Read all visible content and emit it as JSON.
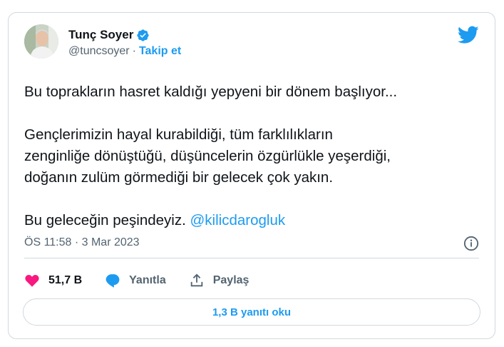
{
  "author": {
    "display_name": "Tunç Soyer",
    "handle": "@tuncsoyer",
    "separator": "·",
    "follow_label": "Takip et",
    "verified": true
  },
  "tweet": {
    "line1": "Bu toprakların hasret kaldığı yepyeni bir dönem başlıyor...",
    "line2": "Gençlerimizin hayal kurabildiği, tüm farklılıkların",
    "line3": "zenginliğe dönüştüğü, düşüncelerin özgürlükle yeşerdiği,",
    "line4": "doğanın zulüm görmediği bir gelecek çok yakın.",
    "line5": "Bu geleceğin peşindeyiz.",
    "mention": "@kilicdarogluk"
  },
  "meta": {
    "timestamp": "ÖS 11:58 · 3 Mar 2023"
  },
  "actions": {
    "like_count": "51,7 B",
    "reply_label": "Yanıtla",
    "share_label": "Paylaş"
  },
  "replies_button": {
    "label": "1,3 B yanıtı oku"
  },
  "colors": {
    "accent": "#1d9bf0",
    "like": "#f91880",
    "text": "#0f1419",
    "secondary": "#536471",
    "border": "#cfd9de"
  },
  "icons": [
    "verified-icon",
    "twitter-bird-icon",
    "info-icon",
    "heart-icon",
    "reply-icon",
    "share-icon"
  ]
}
